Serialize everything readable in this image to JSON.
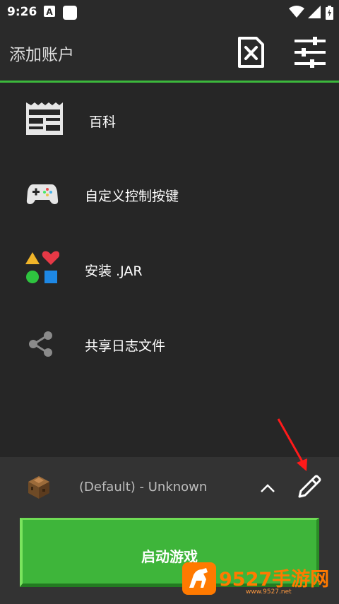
{
  "status_bar": {
    "time": "9:26"
  },
  "app_bar": {
    "title": "添加账户"
  },
  "menu": {
    "items": [
      {
        "label": "百科",
        "icon": "wiki-icon"
      },
      {
        "label": "自定义控制按键",
        "icon": "gamepad-icon"
      },
      {
        "label": "安装 .JAR",
        "icon": "shapes-icon"
      },
      {
        "label": "共享日志文件",
        "icon": "share-icon"
      }
    ]
  },
  "bottom": {
    "version_label": "(Default) - Unknown",
    "launch_label": "启动游戏"
  },
  "watermark": {
    "text": "9527手游网",
    "sub": "www.9527.net"
  }
}
